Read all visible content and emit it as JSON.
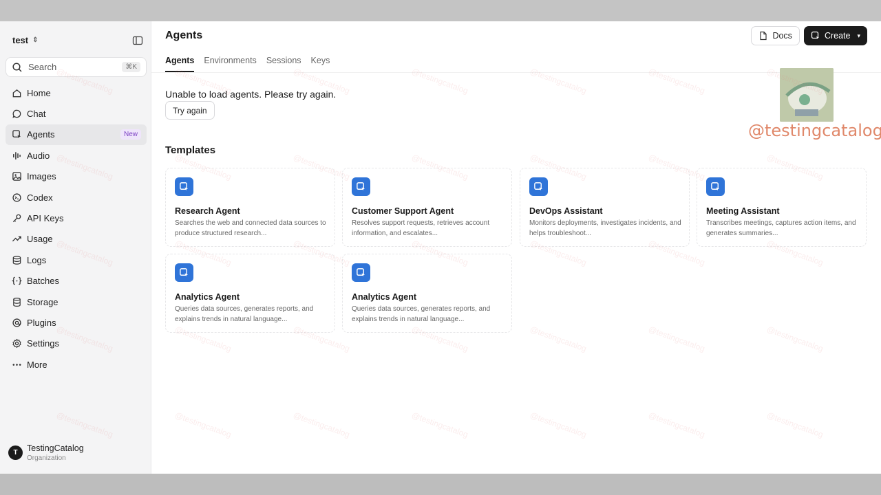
{
  "sidebar": {
    "project": "test",
    "search": {
      "label": "Search",
      "shortcut": "⌘K"
    },
    "items": [
      {
        "label": "Home",
        "icon": "home-icon"
      },
      {
        "label": "Chat",
        "icon": "chat-icon"
      },
      {
        "label": "Agents",
        "icon": "agents-icon",
        "badge": "New",
        "active": true
      },
      {
        "label": "Audio",
        "icon": "audio-icon"
      },
      {
        "label": "Images",
        "icon": "images-icon"
      },
      {
        "label": "Codex",
        "icon": "codex-icon"
      },
      {
        "label": "API Keys",
        "icon": "key-icon"
      },
      {
        "label": "Usage",
        "icon": "usage-icon"
      },
      {
        "label": "Logs",
        "icon": "logs-icon"
      },
      {
        "label": "Batches",
        "icon": "batches-icon"
      },
      {
        "label": "Storage",
        "icon": "storage-icon"
      },
      {
        "label": "Plugins",
        "icon": "plugins-icon"
      },
      {
        "label": "Settings",
        "icon": "settings-icon"
      },
      {
        "label": "More",
        "icon": "more-icon"
      }
    ],
    "org": {
      "initial": "T",
      "name": "TestingCatalog",
      "type": "Organization"
    }
  },
  "header": {
    "title": "Agents",
    "docs_label": "Docs",
    "create_label": "Create"
  },
  "tabs": [
    {
      "label": "Agents",
      "active": true
    },
    {
      "label": "Environments"
    },
    {
      "label": "Sessions"
    },
    {
      "label": "Keys"
    }
  ],
  "error": {
    "message": "Unable to load agents. Please try again.",
    "retry_label": "Try again"
  },
  "templates": {
    "title": "Templates",
    "cards": [
      {
        "title": "Research Agent",
        "desc": "Searches the web and connected data sources to produce structured research..."
      },
      {
        "title": "Customer Support Agent",
        "desc": "Resolves support requests, retrieves account information, and escalates..."
      },
      {
        "title": "DevOps Assistant",
        "desc": "Monitors deployments, investigates incidents, and helps troubleshoot..."
      },
      {
        "title": "Meeting Assistant",
        "desc": "Transcribes meetings, captures action items, and generates summaries..."
      },
      {
        "title": "Analytics Agent",
        "desc": "Queries data sources, generates reports, and explains trends in natural language..."
      },
      {
        "title": "Analytics Agent",
        "desc": "Queries data sources, generates reports, and explains trends in natural language..."
      }
    ]
  },
  "watermark": {
    "text": "@testingcatalog",
    "faint": "@testingcatalog"
  },
  "colors": {
    "accent": "#2f74d8",
    "badge": "#7b3fc4",
    "watermark": "#e0886a"
  }
}
